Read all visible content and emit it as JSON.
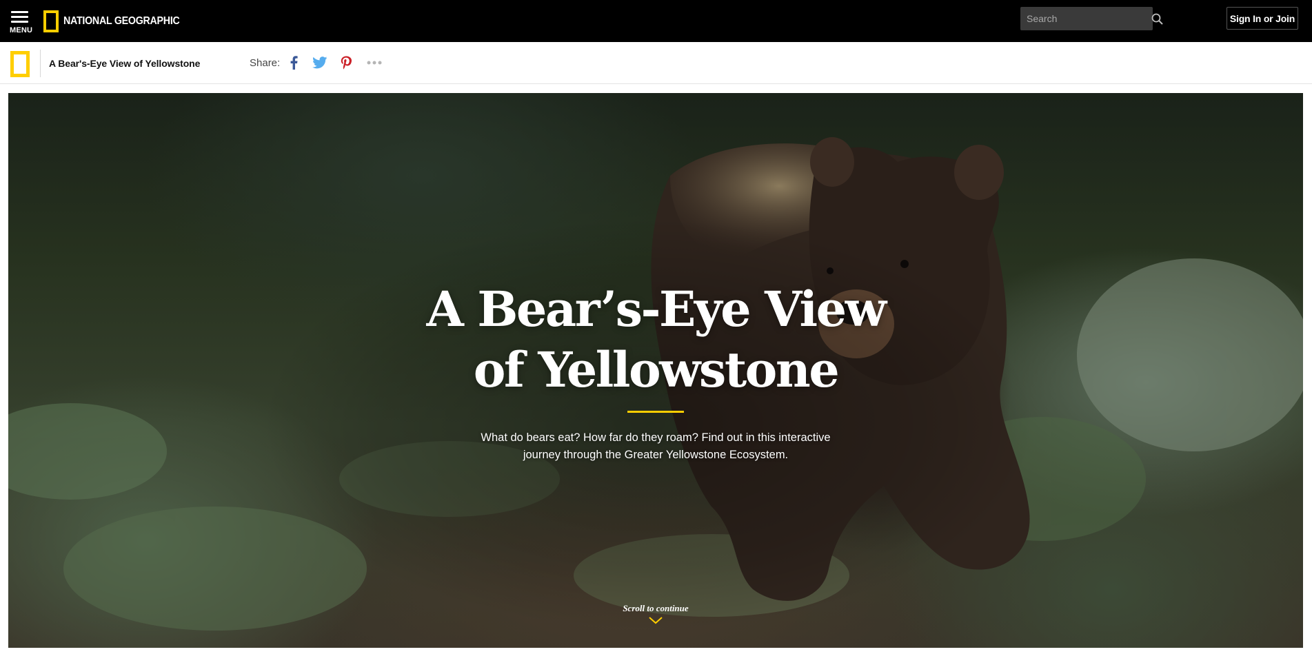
{
  "header": {
    "menu_label": "MENU",
    "brand_name": "NATIONAL GEOGRAPHIC",
    "search": {
      "placeholder": "Search",
      "value": ""
    },
    "signin_label": "Sign In or Join"
  },
  "article_bar": {
    "title": "A Bear's-Eye View of Yellowstone",
    "share_label": "Share:",
    "share_icons": [
      "facebook-icon",
      "twitter-icon",
      "pinterest-icon",
      "more-icon"
    ]
  },
  "hero": {
    "title_line1": "A Bear’s-Eye View",
    "title_line2": "of Yellowstone",
    "dek_line1": "What do bears eat? How far do they roam? Find out in this interactive",
    "dek_line2": "journey through the Greater Yellowstone Ecosystem.",
    "scroll_label": "Scroll to continue"
  },
  "colors": {
    "accent_yellow": "#ffce00",
    "top_bar": "#000000",
    "facebook_blue": "#3b5998",
    "twitter_blue": "#55acee",
    "pinterest_red": "#cb2027"
  }
}
